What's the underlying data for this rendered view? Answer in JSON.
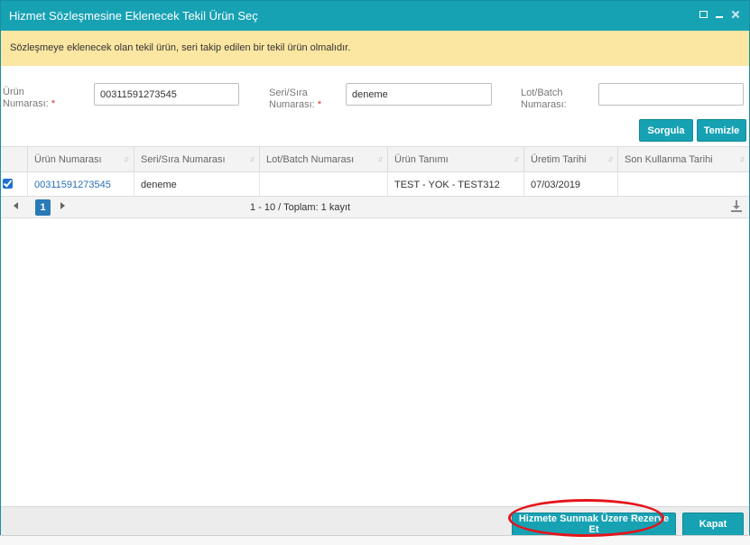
{
  "dialog": {
    "title": "Hizmet Sözleşmesine Eklenecek Tekil Ürün Seç",
    "controls": {
      "maximize_icon": "maximize-icon",
      "minimize_icon": "minimize-icon",
      "close_icon": "close-icon"
    }
  },
  "warning": {
    "text": "Sözleşmeye eklenecek olan tekil ürün, seri takip edilen bir tekil ürün olmalıdır."
  },
  "filters": {
    "urun_no": {
      "label_line1": "Ürün",
      "label_line2": "Numarası:",
      "required": "*",
      "value": "00311591273545"
    },
    "seri_no": {
      "label_line1": "Seri/Sıra",
      "label_line2": "Numarası:",
      "required": "*",
      "value": "deneme"
    },
    "lot_no": {
      "label_line1": "Lot/Batch",
      "label_line2": "Numarası:",
      "value": ""
    }
  },
  "buttons": {
    "query": "Sorgula",
    "clear": "Temizle",
    "reserve": "Hizmete Sunmak Üzere Rezerve Et",
    "close": "Kapat"
  },
  "grid": {
    "columns": [
      "Ürün Numarası",
      "Seri/Sıra Numarası",
      "Lot/Batch Numarası",
      "Ürün Tanımı",
      "Üretim Tarihi",
      "Son Kullanma Tarihi"
    ],
    "rows": [
      {
        "selected": true,
        "urun_no": "00311591273545",
        "seri_no": "deneme",
        "lot_no": "",
        "urun_tanimi": "TEST - YOK - TEST312",
        "uretim_tarihi": "07/03/2019",
        "son_kullanma": ""
      }
    ]
  },
  "pager": {
    "current_page": "1",
    "info": "1 - 10 / Toplam: 1 kayıt"
  },
  "colors": {
    "accent": "#17a2b4",
    "warning_bg": "#fbe6a2",
    "link": "#2a6fb5",
    "required": "#d9342b",
    "highlight": "#e4141b"
  }
}
